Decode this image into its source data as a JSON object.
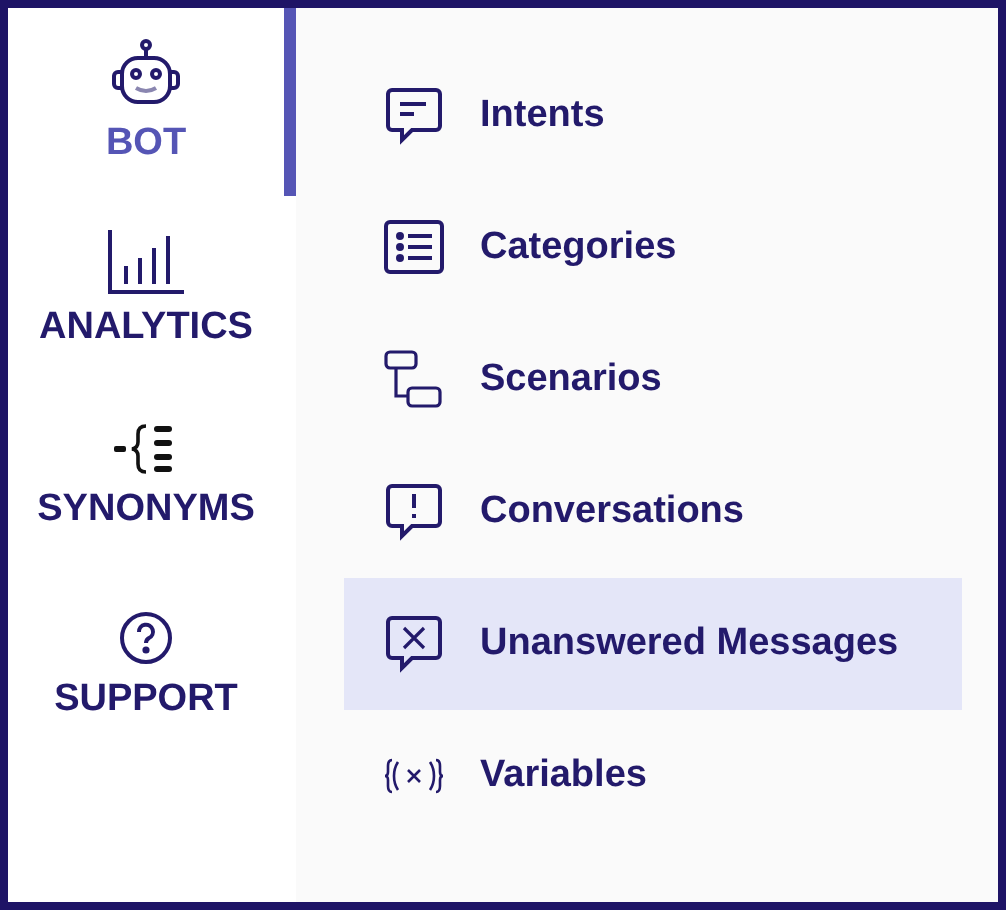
{
  "rail": [
    {
      "label": "BOT",
      "selected": true
    },
    {
      "label": "ANALYTICS",
      "selected": false
    },
    {
      "label": "SYNONYMS",
      "selected": false
    },
    {
      "label": "SUPPORT",
      "selected": false
    }
  ],
  "menu": [
    {
      "label": "Intents",
      "selected": false
    },
    {
      "label": "Categories",
      "selected": false
    },
    {
      "label": "Scenarios",
      "selected": false
    },
    {
      "label": "Conversations",
      "selected": false
    },
    {
      "label": "Unanswered Messages",
      "selected": true
    },
    {
      "label": "Variables",
      "selected": false
    }
  ]
}
